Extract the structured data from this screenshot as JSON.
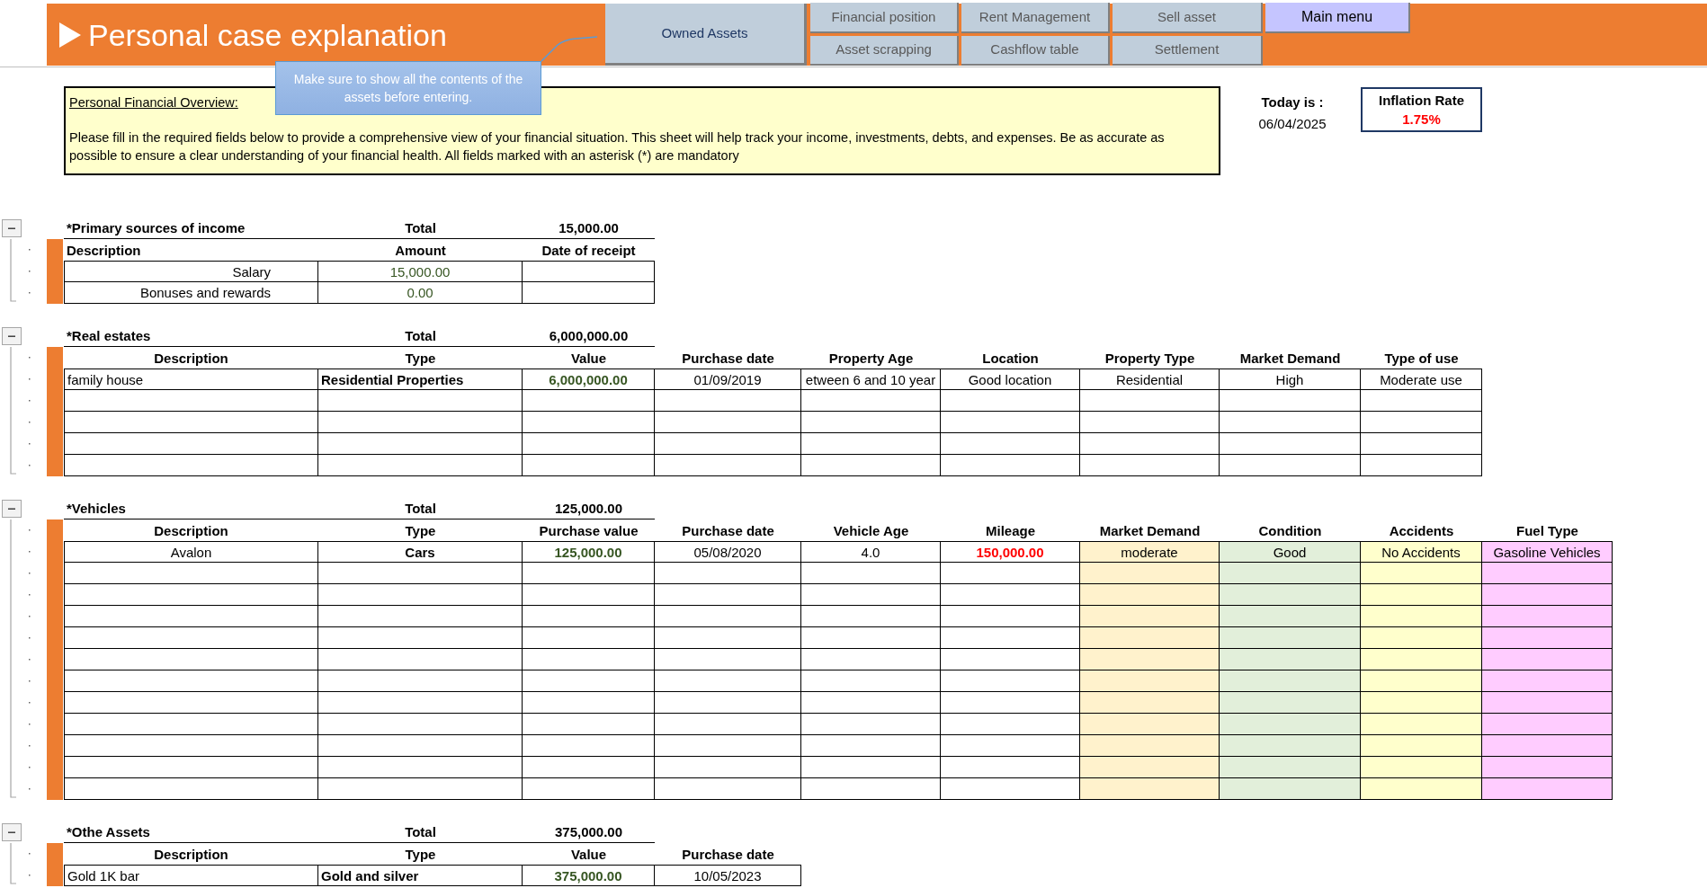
{
  "header": {
    "title": "Personal case explanation"
  },
  "owned_assets": {
    "label": "Owned Assets"
  },
  "nav_buttons": [
    {
      "label": "Financial position",
      "kind": "grid"
    },
    {
      "label": "Rent Management",
      "kind": "grid"
    },
    {
      "label": "Sell asset",
      "kind": "grid"
    },
    {
      "label": "Main menu",
      "kind": "menu"
    },
    {
      "label": "Asset scrapping",
      "kind": "grid"
    },
    {
      "label": "Cashflow table",
      "kind": "grid"
    },
    {
      "label": "Settlement",
      "kind": "grid"
    }
  ],
  "callout": "Make sure to show all the contents of the assets before entering.",
  "overview": {
    "heading": "Personal Financial Overview:",
    "text": "Please fill in the required fields below to provide a comprehensive view of your financial situation. This sheet will help track your income, investments, debts, and expenses. Be as accurate as possible to ensure a clear understanding of your financial health. All fields marked with an asterisk (*) are mandatory"
  },
  "today": {
    "label": "Today is :",
    "value": "06/04/2025"
  },
  "inflation": {
    "label": "Inflation Rate",
    "value": "1.75%"
  },
  "sections": [
    {
      "title": "*Primary sources of income",
      "total_label": "Total",
      "total": "15,000.00",
      "expanded": true,
      "columns": [
        {
          "label": "Description",
          "kind": "plain"
        },
        {
          "label": "Amount",
          "kind": "money"
        },
        {
          "label": "Date of receipt",
          "kind": "plain"
        }
      ],
      "rows": [
        {
          "cells": [
            "Salary",
            "15,000.00",
            null
          ]
        },
        {
          "cells": [
            "Bonuses and rewards",
            "0.00",
            null
          ]
        }
      ]
    },
    {
      "title": "*Real estates",
      "total_label": "Total",
      "total": "6,000,000.00",
      "expanded": true,
      "columns": [
        {
          "label": "Description",
          "kind": "plain"
        },
        {
          "label": "Type",
          "kind": "strong"
        },
        {
          "label": "Value",
          "kind": "strong_money"
        },
        {
          "label": "Purchase date",
          "kind": "plain"
        },
        {
          "label": "Property Age",
          "kind": "plain"
        },
        {
          "label": "Location",
          "kind": "plain"
        },
        {
          "label": "Property Type",
          "kind": "plain"
        },
        {
          "label": "Market Demand",
          "kind": "plain"
        },
        {
          "label": "Type of use",
          "kind": "plain"
        }
      ],
      "rows": [
        {
          "cells": [
            "family house",
            "Residential Properties",
            "6,000,000.00",
            "01/09/2019",
            "etween 6 and 10 year",
            "Good location",
            "Residential",
            "High",
            "Moderate use"
          ]
        },
        {
          "blank": true
        },
        {
          "blank": true
        },
        {
          "blank": true
        },
        {
          "blank": true
        }
      ]
    },
    {
      "title": "*Vehicles",
      "total_label": "Total",
      "total": "125,000.00",
      "expanded": true,
      "columns": [
        {
          "label": "Description",
          "kind": "plain"
        },
        {
          "label": "Type",
          "kind": "strong"
        },
        {
          "label": "Purchase value",
          "kind": "strong_money"
        },
        {
          "label": "Purchase date",
          "kind": "plain"
        },
        {
          "label": "Vehicle Age",
          "kind": "plain"
        },
        {
          "label": "Mileage",
          "kind": "alert"
        },
        {
          "label": "Market Demand",
          "kind": "plain",
          "color": "#fff2cc"
        },
        {
          "label": "Condition",
          "kind": "plain",
          "color": "#e2efda"
        },
        {
          "label": "Accidents",
          "kind": "plain",
          "color": "#ffffcc"
        },
        {
          "label": "Fuel Type",
          "kind": "plain",
          "color": "#ffccff"
        }
      ],
      "rows": [
        {
          "cells": [
            "Avalon",
            "Cars",
            "125,000.00",
            "05/08/2020",
            "4.0",
            "150,000.00",
            "moderate",
            "Good",
            "No Accidents",
            "Gasoline Vehicles"
          ]
        },
        {
          "blank": true
        },
        {
          "blank": true
        },
        {
          "blank": true
        },
        {
          "blank": true
        },
        {
          "blank": true
        },
        {
          "blank": true
        },
        {
          "blank": true
        },
        {
          "blank": true
        },
        {
          "blank": true
        },
        {
          "blank": true
        },
        {
          "blank": true
        }
      ]
    },
    {
      "title": "*Othe Assets",
      "total_label": "Total",
      "total": "375,000.00",
      "expanded": true,
      "columns": [
        {
          "label": "Description",
          "kind": "plain"
        },
        {
          "label": "Type",
          "kind": "strong"
        },
        {
          "label": "Value",
          "kind": "strong_money"
        },
        {
          "label": "Purchase date",
          "kind": "plain"
        }
      ],
      "rows": [
        {
          "cells": [
            "Gold 1K bar",
            "Gold and silver",
            "375,000.00",
            "10/05/2023"
          ]
        }
      ]
    }
  ]
}
